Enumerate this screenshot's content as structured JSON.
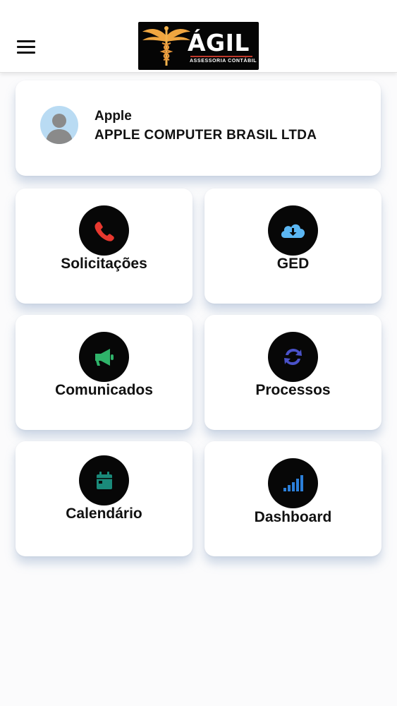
{
  "header": {
    "menu_icon": "hamburger-menu-icon",
    "logo": {
      "title": "ÁGIL",
      "subtitle": "ASSESSORIA CONTÁBIL",
      "emblem_icon": "caduceus-icon"
    }
  },
  "profile": {
    "name": "Apple",
    "company": "APPLE COMPUTER BRASIL LTDA",
    "avatar_icon": "user-avatar-icon"
  },
  "tiles": [
    {
      "label": "Solicitações",
      "icon": "phone-icon",
      "color": "#e8382f"
    },
    {
      "label": "GED",
      "icon": "cloud-download-icon",
      "color": "#5bb6f2"
    },
    {
      "label": "Comunicados",
      "icon": "megaphone-icon",
      "color": "#2fb36a"
    },
    {
      "label": "Processos",
      "icon": "sync-icon",
      "color": "#4a52c9"
    },
    {
      "label": "Calendário",
      "icon": "calendar-icon",
      "color": "#1a8a7a"
    },
    {
      "label": "Dashboard",
      "icon": "signal-bars-icon",
      "color": "#2b7fd9"
    }
  ]
}
